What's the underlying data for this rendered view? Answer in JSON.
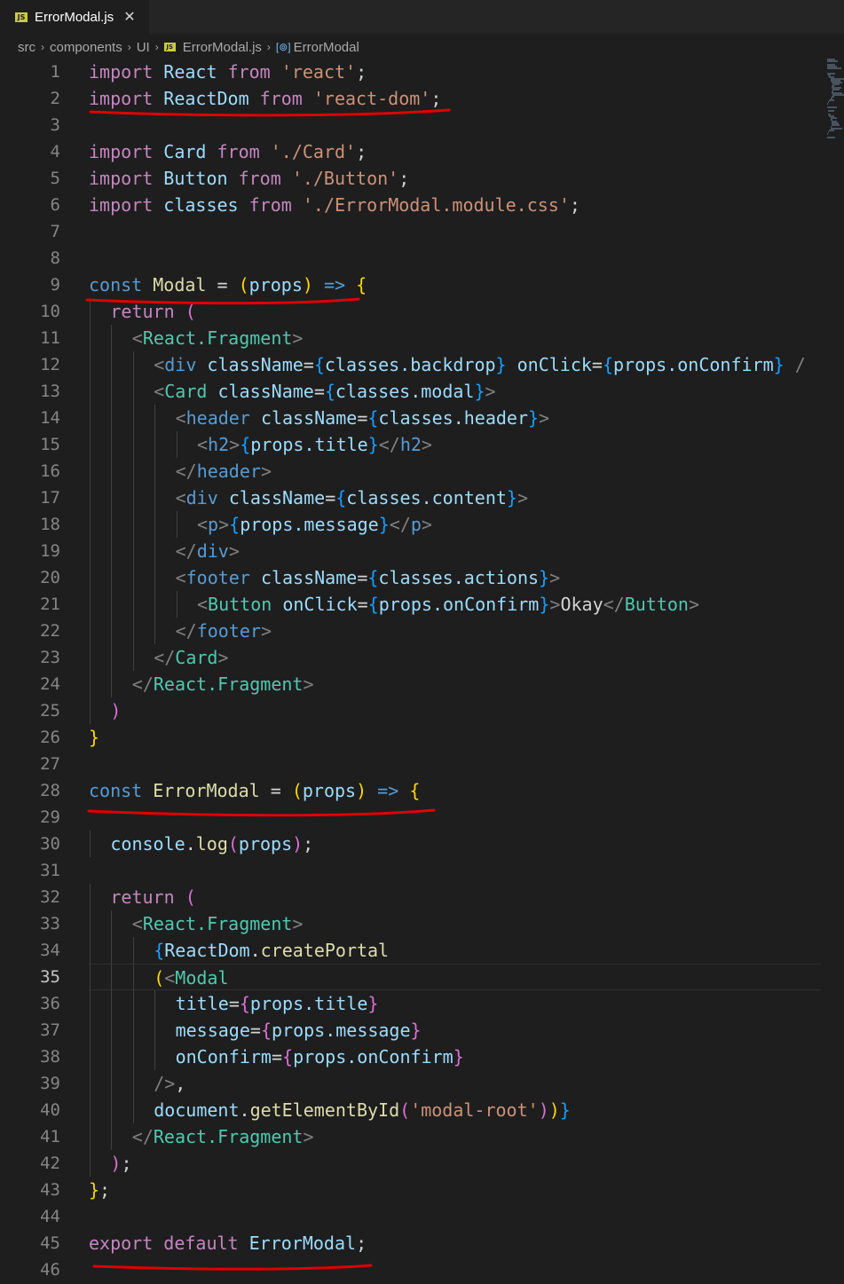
{
  "tab": {
    "title": "ErrorModal.js",
    "close_glyph": "✕",
    "file_icon": "JS"
  },
  "breadcrumb": {
    "items": [
      "src",
      "components",
      "UI",
      "ErrorModal.js",
      "ErrorModal"
    ],
    "separator": "›",
    "file_icon": "JS",
    "symbol_icon": "[⊚]"
  },
  "editor": {
    "current_line": 35,
    "colors": {
      "keyword": "#c586c0",
      "storage": "#569cd6",
      "variable": "#9cdcfe",
      "string": "#ce9178",
      "function": "#dcdcaa",
      "tag": "#4ec9b0",
      "punct": "#d4d4d4",
      "jsxbracket": "#808080",
      "brace1": "#ffd700",
      "brace2": "#da70d6",
      "brace3": "#179fff",
      "line_number": "#858585",
      "underline": "#e00000"
    },
    "lines": [
      {
        "n": "1",
        "indent": 0,
        "tokens": [
          [
            "import",
            "keyword"
          ],
          [
            " ",
            "punct"
          ],
          [
            "React",
            "variable"
          ],
          [
            " ",
            "punct"
          ],
          [
            "from",
            "keyword"
          ],
          [
            " ",
            "punct"
          ],
          [
            "'react'",
            "string"
          ],
          [
            ";",
            "punct"
          ]
        ]
      },
      {
        "n": "2",
        "indent": 0,
        "tokens": [
          [
            "import",
            "keyword"
          ],
          [
            " ",
            "punct"
          ],
          [
            "ReactDom",
            "variable"
          ],
          [
            " ",
            "punct"
          ],
          [
            "from",
            "keyword"
          ],
          [
            " ",
            "punct"
          ],
          [
            "'react-dom'",
            "string"
          ],
          [
            ";",
            "punct"
          ]
        ]
      },
      {
        "n": "3",
        "indent": 0,
        "tokens": []
      },
      {
        "n": "4",
        "indent": 0,
        "tokens": [
          [
            "import",
            "keyword"
          ],
          [
            " ",
            "punct"
          ],
          [
            "Card",
            "variable"
          ],
          [
            " ",
            "punct"
          ],
          [
            "from",
            "keyword"
          ],
          [
            " ",
            "punct"
          ],
          [
            "'./Card'",
            "string"
          ],
          [
            ";",
            "punct"
          ]
        ]
      },
      {
        "n": "5",
        "indent": 0,
        "tokens": [
          [
            "import",
            "keyword"
          ],
          [
            " ",
            "punct"
          ],
          [
            "Button",
            "variable"
          ],
          [
            " ",
            "punct"
          ],
          [
            "from",
            "keyword"
          ],
          [
            " ",
            "punct"
          ],
          [
            "'./Button'",
            "string"
          ],
          [
            ";",
            "punct"
          ]
        ]
      },
      {
        "n": "6",
        "indent": 0,
        "tokens": [
          [
            "import",
            "keyword"
          ],
          [
            " ",
            "punct"
          ],
          [
            "classes",
            "variable"
          ],
          [
            " ",
            "punct"
          ],
          [
            "from",
            "keyword"
          ],
          [
            " ",
            "punct"
          ],
          [
            "'./ErrorModal.module.css'",
            "string"
          ],
          [
            ";",
            "punct"
          ]
        ]
      },
      {
        "n": "7",
        "indent": 0,
        "tokens": []
      },
      {
        "n": "8",
        "indent": 0,
        "tokens": []
      },
      {
        "n": "9",
        "indent": 0,
        "tokens": [
          [
            "const",
            "storage"
          ],
          [
            " ",
            "punct"
          ],
          [
            "Modal",
            "function"
          ],
          [
            " = ",
            "punct"
          ],
          [
            "(",
            "brace1"
          ],
          [
            "props",
            "variable"
          ],
          [
            ")",
            "brace1"
          ],
          [
            " ",
            "punct"
          ],
          [
            "=>",
            "storage"
          ],
          [
            " ",
            "punct"
          ],
          [
            "{",
            "brace1"
          ]
        ]
      },
      {
        "n": "10",
        "indent": 1,
        "tokens": [
          [
            "return",
            "keyword"
          ],
          [
            " ",
            "punct"
          ],
          [
            "(",
            "brace2"
          ]
        ]
      },
      {
        "n": "11",
        "indent": 2,
        "tokens": [
          [
            "<",
            "jsxbracket"
          ],
          [
            "React.Fragment",
            "tag"
          ],
          [
            ">",
            "jsxbracket"
          ]
        ]
      },
      {
        "n": "12",
        "indent": 3,
        "tokens": [
          [
            "<",
            "jsxbracket"
          ],
          [
            "div",
            "storage"
          ],
          [
            " ",
            "punct"
          ],
          [
            "className",
            "variable"
          ],
          [
            "=",
            "punct"
          ],
          [
            "{",
            "brace3"
          ],
          [
            "classes.backdrop",
            "variable"
          ],
          [
            "}",
            "brace3"
          ],
          [
            " ",
            "punct"
          ],
          [
            "onClick",
            "variable"
          ],
          [
            "=",
            "punct"
          ],
          [
            "{",
            "brace3"
          ],
          [
            "props.onConfirm",
            "variable"
          ],
          [
            "}",
            "brace3"
          ],
          [
            " /",
            "jsxbracket"
          ]
        ]
      },
      {
        "n": "13",
        "indent": 3,
        "tokens": [
          [
            "<",
            "jsxbracket"
          ],
          [
            "Card",
            "tag"
          ],
          [
            " ",
            "punct"
          ],
          [
            "className",
            "variable"
          ],
          [
            "=",
            "punct"
          ],
          [
            "{",
            "brace3"
          ],
          [
            "classes.modal",
            "variable"
          ],
          [
            "}",
            "brace3"
          ],
          [
            ">",
            "jsxbracket"
          ]
        ]
      },
      {
        "n": "14",
        "indent": 4,
        "tokens": [
          [
            "<",
            "jsxbracket"
          ],
          [
            "header",
            "storage"
          ],
          [
            " ",
            "punct"
          ],
          [
            "className",
            "variable"
          ],
          [
            "=",
            "punct"
          ],
          [
            "{",
            "brace3"
          ],
          [
            "classes.header",
            "variable"
          ],
          [
            "}",
            "brace3"
          ],
          [
            ">",
            "jsxbracket"
          ]
        ]
      },
      {
        "n": "15",
        "indent": 5,
        "tokens": [
          [
            "<",
            "jsxbracket"
          ],
          [
            "h2",
            "storage"
          ],
          [
            ">",
            "jsxbracket"
          ],
          [
            "{",
            "brace3"
          ],
          [
            "props.title",
            "variable"
          ],
          [
            "}",
            "brace3"
          ],
          [
            "</",
            "jsxbracket"
          ],
          [
            "h2",
            "storage"
          ],
          [
            ">",
            "jsxbracket"
          ]
        ]
      },
      {
        "n": "16",
        "indent": 4,
        "tokens": [
          [
            "</",
            "jsxbracket"
          ],
          [
            "header",
            "storage"
          ],
          [
            ">",
            "jsxbracket"
          ]
        ]
      },
      {
        "n": "17",
        "indent": 4,
        "tokens": [
          [
            "<",
            "jsxbracket"
          ],
          [
            "div",
            "storage"
          ],
          [
            " ",
            "punct"
          ],
          [
            "className",
            "variable"
          ],
          [
            "=",
            "punct"
          ],
          [
            "{",
            "brace3"
          ],
          [
            "classes.content",
            "variable"
          ],
          [
            "}",
            "brace3"
          ],
          [
            ">",
            "jsxbracket"
          ]
        ]
      },
      {
        "n": "18",
        "indent": 5,
        "tokens": [
          [
            "<",
            "jsxbracket"
          ],
          [
            "p",
            "storage"
          ],
          [
            ">",
            "jsxbracket"
          ],
          [
            "{",
            "brace3"
          ],
          [
            "props.message",
            "variable"
          ],
          [
            "}",
            "brace3"
          ],
          [
            "</",
            "jsxbracket"
          ],
          [
            "p",
            "storage"
          ],
          [
            ">",
            "jsxbracket"
          ]
        ]
      },
      {
        "n": "19",
        "indent": 4,
        "tokens": [
          [
            "</",
            "jsxbracket"
          ],
          [
            "div",
            "storage"
          ],
          [
            ">",
            "jsxbracket"
          ]
        ]
      },
      {
        "n": "20",
        "indent": 4,
        "tokens": [
          [
            "<",
            "jsxbracket"
          ],
          [
            "footer",
            "storage"
          ],
          [
            " ",
            "punct"
          ],
          [
            "className",
            "variable"
          ],
          [
            "=",
            "punct"
          ],
          [
            "{",
            "brace3"
          ],
          [
            "classes.actions",
            "variable"
          ],
          [
            "}",
            "brace3"
          ],
          [
            ">",
            "jsxbracket"
          ]
        ]
      },
      {
        "n": "21",
        "indent": 5,
        "tokens": [
          [
            "<",
            "jsxbracket"
          ],
          [
            "Button",
            "tag"
          ],
          [
            " ",
            "punct"
          ],
          [
            "onClick",
            "variable"
          ],
          [
            "=",
            "punct"
          ],
          [
            "{",
            "brace3"
          ],
          [
            "props.onConfirm",
            "variable"
          ],
          [
            "}",
            "brace3"
          ],
          [
            ">",
            "jsxbracket"
          ],
          [
            "Okay",
            "punct"
          ],
          [
            "</",
            "jsxbracket"
          ],
          [
            "Button",
            "tag"
          ],
          [
            ">",
            "jsxbracket"
          ]
        ]
      },
      {
        "n": "22",
        "indent": 4,
        "tokens": [
          [
            "</",
            "jsxbracket"
          ],
          [
            "footer",
            "storage"
          ],
          [
            ">",
            "jsxbracket"
          ]
        ]
      },
      {
        "n": "23",
        "indent": 3,
        "tokens": [
          [
            "</",
            "jsxbracket"
          ],
          [
            "Card",
            "tag"
          ],
          [
            ">",
            "jsxbracket"
          ]
        ]
      },
      {
        "n": "24",
        "indent": 2,
        "tokens": [
          [
            "</",
            "jsxbracket"
          ],
          [
            "React.Fragment",
            "tag"
          ],
          [
            ">",
            "jsxbracket"
          ]
        ]
      },
      {
        "n": "25",
        "indent": 1,
        "tokens": [
          [
            ")",
            "brace2"
          ]
        ]
      },
      {
        "n": "26",
        "indent": 0,
        "tokens": [
          [
            "}",
            "brace1"
          ]
        ]
      },
      {
        "n": "27",
        "indent": 0,
        "tokens": []
      },
      {
        "n": "28",
        "indent": 0,
        "tokens": [
          [
            "const",
            "storage"
          ],
          [
            " ",
            "punct"
          ],
          [
            "ErrorModal",
            "function"
          ],
          [
            " = ",
            "punct"
          ],
          [
            "(",
            "brace1"
          ],
          [
            "props",
            "variable"
          ],
          [
            ")",
            "brace1"
          ],
          [
            " ",
            "punct"
          ],
          [
            "=>",
            "storage"
          ],
          [
            " ",
            "punct"
          ],
          [
            "{",
            "brace1"
          ]
        ]
      },
      {
        "n": "29",
        "indent": 0,
        "tokens": []
      },
      {
        "n": "30",
        "indent": 1,
        "tokens": [
          [
            "console",
            "variable"
          ],
          [
            ".",
            "punct"
          ],
          [
            "log",
            "function"
          ],
          [
            "(",
            "brace2"
          ],
          [
            "props",
            "variable"
          ],
          [
            ")",
            "brace2"
          ],
          [
            ";",
            "punct"
          ]
        ]
      },
      {
        "n": "31",
        "indent": 0,
        "tokens": []
      },
      {
        "n": "32",
        "indent": 1,
        "tokens": [
          [
            "return",
            "keyword"
          ],
          [
            " ",
            "punct"
          ],
          [
            "(",
            "brace2"
          ]
        ]
      },
      {
        "n": "33",
        "indent": 2,
        "tokens": [
          [
            "<",
            "jsxbracket"
          ],
          [
            "React.Fragment",
            "tag"
          ],
          [
            ">",
            "jsxbracket"
          ]
        ]
      },
      {
        "n": "34",
        "indent": 3,
        "tokens": [
          [
            "{",
            "brace3"
          ],
          [
            "ReactDom",
            "variable"
          ],
          [
            ".",
            "punct"
          ],
          [
            "createPortal",
            "function"
          ]
        ]
      },
      {
        "n": "35",
        "indent": 3,
        "tokens": [
          [
            "(",
            "brace1"
          ],
          [
            "<",
            "jsxbracket"
          ],
          [
            "Modal",
            "tag"
          ]
        ]
      },
      {
        "n": "36",
        "indent": 4,
        "tokens": [
          [
            "title",
            "variable"
          ],
          [
            "=",
            "punct"
          ],
          [
            "{",
            "brace2"
          ],
          [
            "props.title",
            "variable"
          ],
          [
            "}",
            "brace2"
          ]
        ]
      },
      {
        "n": "37",
        "indent": 4,
        "tokens": [
          [
            "message",
            "variable"
          ],
          [
            "=",
            "punct"
          ],
          [
            "{",
            "brace2"
          ],
          [
            "props.message",
            "variable"
          ],
          [
            "}",
            "brace2"
          ]
        ]
      },
      {
        "n": "38",
        "indent": 4,
        "tokens": [
          [
            "onConfirm",
            "variable"
          ],
          [
            "=",
            "punct"
          ],
          [
            "{",
            "brace2"
          ],
          [
            "props.onConfirm",
            "variable"
          ],
          [
            "}",
            "brace2"
          ]
        ]
      },
      {
        "n": "39",
        "indent": 3,
        "tokens": [
          [
            "/>",
            "jsxbracket"
          ],
          [
            ",",
            "punct"
          ]
        ]
      },
      {
        "n": "40",
        "indent": 3,
        "tokens": [
          [
            "document",
            "variable"
          ],
          [
            ".",
            "punct"
          ],
          [
            "getElementById",
            "function"
          ],
          [
            "(",
            "brace2"
          ],
          [
            "'modal-root'",
            "string"
          ],
          [
            ")",
            "brace2"
          ],
          [
            ")",
            "brace1"
          ],
          [
            "}",
            "brace3"
          ]
        ]
      },
      {
        "n": "41",
        "indent": 2,
        "tokens": [
          [
            "</",
            "jsxbracket"
          ],
          [
            "React.Fragment",
            "tag"
          ],
          [
            ">",
            "jsxbracket"
          ]
        ]
      },
      {
        "n": "42",
        "indent": 1,
        "tokens": [
          [
            ")",
            "brace2"
          ],
          [
            ";",
            "punct"
          ]
        ]
      },
      {
        "n": "43",
        "indent": 0,
        "tokens": [
          [
            "}",
            "brace1"
          ],
          [
            ";",
            "punct"
          ]
        ]
      },
      {
        "n": "44",
        "indent": 0,
        "tokens": []
      },
      {
        "n": "45",
        "indent": 0,
        "tokens": [
          [
            "export",
            "keyword"
          ],
          [
            " ",
            "punct"
          ],
          [
            "default",
            "keyword"
          ],
          [
            " ",
            "punct"
          ],
          [
            "ErrorModal",
            "variable"
          ],
          [
            ";",
            "punct"
          ]
        ]
      },
      {
        "n": "46",
        "indent": 0,
        "tokens": []
      }
    ]
  }
}
